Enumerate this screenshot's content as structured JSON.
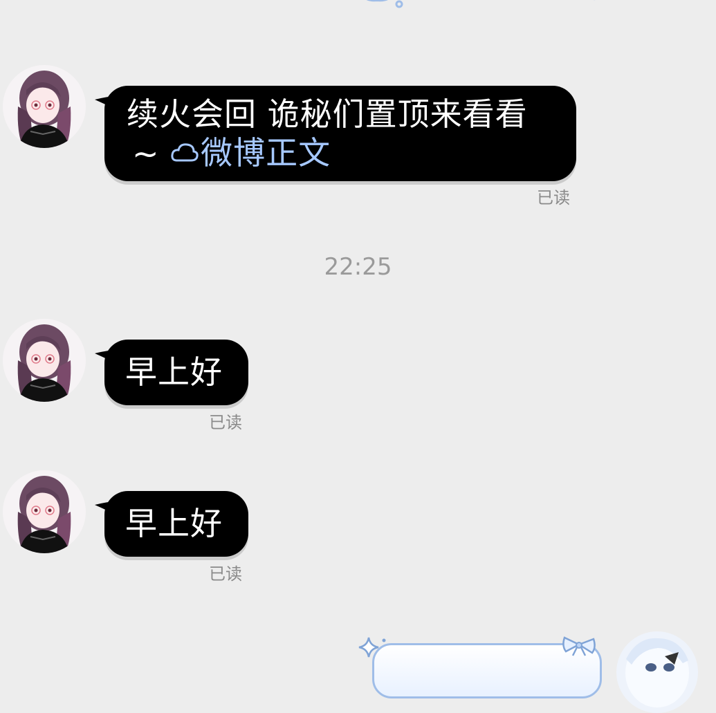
{
  "colors": {
    "background": "#ededed",
    "bubble": "#000000",
    "bubble_text": "#ffffff",
    "link": "#a6c8ff",
    "read_status": "#8a8a8a",
    "timestamp": "#9a9a9a",
    "decor_blue": "#9fbde8"
  },
  "messages": [
    {
      "line1": "续火会回 诡秘们置顶来看看",
      "line2_prefix": "~",
      "link_icon": "weibo-cloud-icon",
      "link_text": "微博正文",
      "status": "已读"
    },
    {
      "text": "早上好",
      "status": "已读"
    },
    {
      "text": "早上好",
      "status": "已读"
    }
  ],
  "timestamp": "22:25",
  "icons": {
    "avatar_left": "anime-avatar-icon",
    "avatar_right": "anime-avatar-icon",
    "sparkle": "sparkle-icon",
    "bow": "bow-icon"
  }
}
